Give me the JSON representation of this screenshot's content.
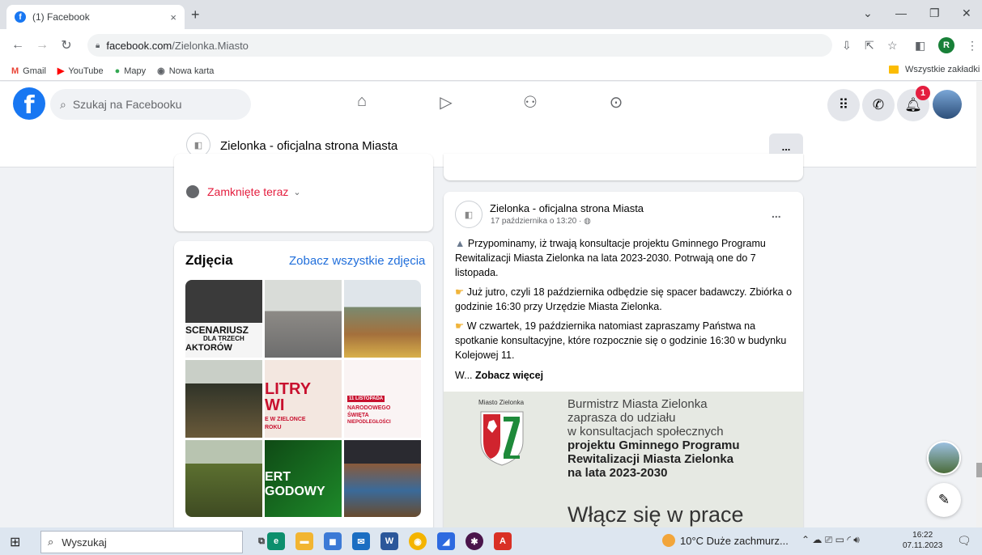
{
  "browser": {
    "tab_title": "(1) Facebook",
    "tab_close": "×",
    "new_tab": "+",
    "url_host": "facebook.com",
    "url_path": "/Zielonka.Miasto",
    "bookmarks": [
      {
        "label": "Gmail",
        "icon": "gmail-icon",
        "glyph": "M",
        "color": "#ea4335"
      },
      {
        "label": "YouTube",
        "icon": "youtube-icon",
        "glyph": "▶",
        "color": "#ff0000"
      },
      {
        "label": "Mapy",
        "icon": "maps-icon",
        "glyph": "●",
        "color": "#34a853"
      },
      {
        "label": "Nowa karta",
        "icon": "globe-icon",
        "glyph": "◉",
        "color": "#5f6368"
      }
    ],
    "all_bookmarks": "Wszystkie zakładki",
    "profile_initial": "R"
  },
  "facebook": {
    "logo_glyph": "f",
    "search_placeholder": "Szukaj na Facebooku",
    "notification_count": "1",
    "page_name": "Zielonka - oficjalna strona Miasta",
    "more_label": "..."
  },
  "info": {
    "status": "Zamknięte teraz"
  },
  "photos": {
    "title": "Zdjęcia",
    "see_all": "Zobacz wszystkie zdjęcia",
    "captions": [
      "SCENARIUSZ",
      "DLA TRZECH",
      "AKTORÓW",
      "LITRY",
      "WI",
      "E W ZIELONCE",
      "ROKU",
      "11 LISTOPADA",
      "NARODOWEGO",
      "ŚWIĘTA",
      "NIEPODLEGŁOŚCI",
      "ERT",
      "GODOWY"
    ]
  },
  "post": {
    "author": "Zielonka - oficjalna strona Miasta",
    "date": "17 października o 13:20 · ",
    "more": "...",
    "paragraphs": [
      "Przypominamy, iż trwają konsultacje projektu Gminnego Programu Rewitalizacji Miasta Zielonka na lata 2023-2030. Potrwają one do 7 listopada.",
      "Już jutro, czyli 18 października odbędzie się spacer badawczy. Zbiórka o godzinie 16:30 przy Urzędzie Miasta Zielonka.",
      "W czwartek, 19 października natomiast zapraszamy Państwa na spotkanie konsultacyjne, które rozpocznie się o godzinie 16:30 w budynku Kolejowej 11."
    ],
    "truncated": "W... ",
    "see_more": "Zobacz więcej",
    "image": {
      "crest_label": "Miasto Zielonka",
      "line1": "Burmistrz Miasta Zielonka",
      "line2": "zaprasza do udziału",
      "line3": "w konsultacjach społecznych",
      "bold1": "projektu Gminnego Programu",
      "bold2": "Rewitalizacji Miasta Zielonka",
      "bold3": "na lata 2023-2030",
      "big": "Włącz się w prace"
    }
  },
  "taskbar": {
    "search_placeholder": "Wyszukaj",
    "weather": "10°C  Duże zachmurz...",
    "time": "16:22",
    "date": "07.11.2023"
  }
}
